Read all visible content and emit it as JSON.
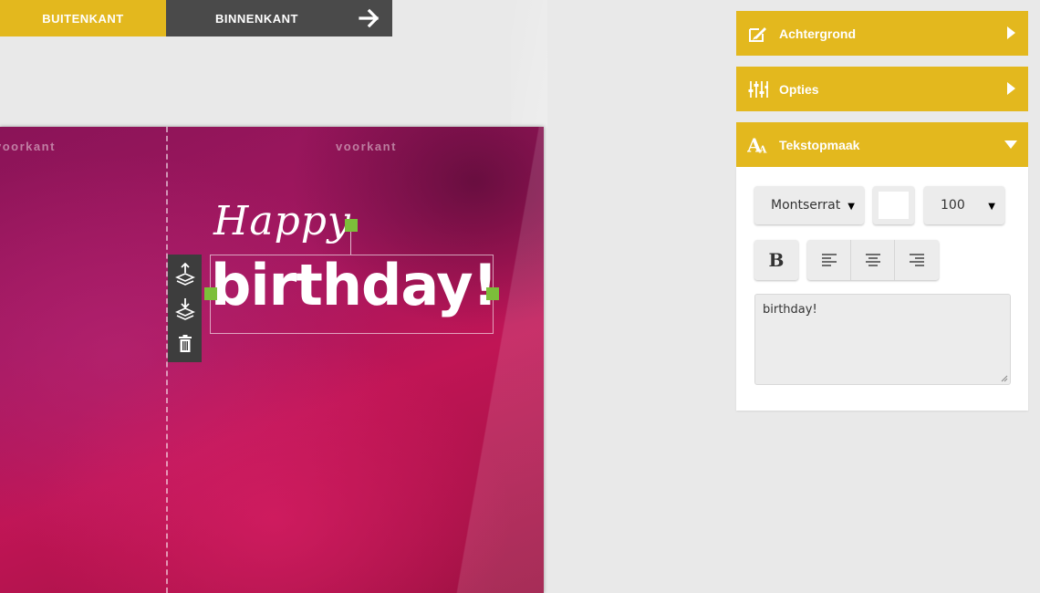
{
  "tabs": {
    "outside_label": "BUITENKANT",
    "inside_label": "BINNENKANT"
  },
  "card": {
    "left_side_label": "voorkant",
    "right_side_label": "voorkant",
    "greeting_line1": "Happy",
    "greeting_line2": "birthday!"
  },
  "panel": {
    "sections": {
      "background": "Achtergrond",
      "options": "Opties",
      "text_format": "Tekstopmaak"
    },
    "font_select": "Montserrat",
    "size_select": "100",
    "text_value": "birthday!"
  },
  "colors": {
    "accent": "#e3b81e",
    "dark_tab": "#4a4a4a",
    "handle": "#7cbf3a",
    "card_pink": "#b0155a",
    "text_color": "#ffffff"
  },
  "icons": {
    "arrow": "arrow-right-icon",
    "background": "background-edit-icon",
    "options": "sliders-icon",
    "text": "text-format-icon",
    "layer_up": "layer-up-icon",
    "layer_down": "layer-down-icon",
    "delete": "trash-icon"
  }
}
